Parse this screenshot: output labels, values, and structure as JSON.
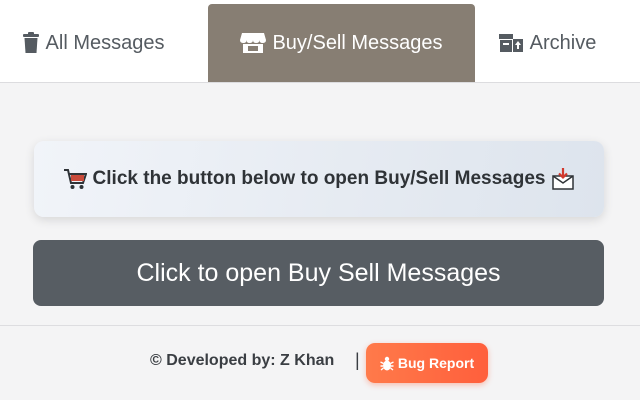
{
  "tabs": [
    {
      "label": "All Messages",
      "icon": "trash-icon",
      "active": false
    },
    {
      "label": "Buy/Sell Messages",
      "icon": "store-icon",
      "active": true
    },
    {
      "label": "Archive",
      "icon": "archive-box-icon",
      "active": false
    }
  ],
  "main": {
    "info_text": "Click the button below to open Buy/Sell Messages",
    "info_icon_left": "shopping-cart-icon",
    "info_icon_right": "inbox-download-icon",
    "open_button_label": "Click to open Buy Sell Messages"
  },
  "footer": {
    "credit": "© Developed by: Z Khan",
    "separator": "|",
    "bug_report_label": "Bug Report",
    "bug_icon": "bug-icon"
  },
  "colors": {
    "active_tab": "#877e73",
    "open_button": "#575d63",
    "bug_button": "#ff6a42",
    "text": "#555b61"
  }
}
